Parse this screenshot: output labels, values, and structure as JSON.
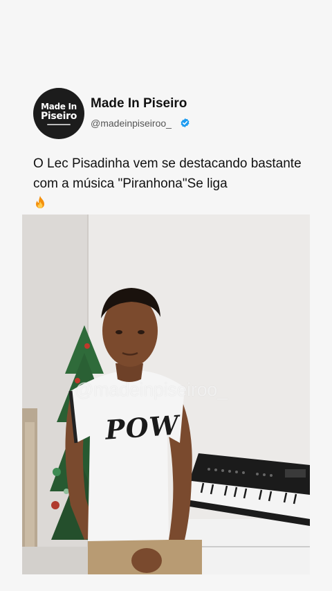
{
  "post": {
    "display_name": "Made In Piseiro",
    "handle": "@madeinpiseiroo_",
    "verified": true,
    "text": "O  Lec Pisadinha vem se destacando bastante com a música \"Piranhona\"Se liga",
    "emoji": "fire-icon"
  },
  "avatar": {
    "line1": "Made In",
    "line2": "Piseiro"
  },
  "media": {
    "watermark": "@madeinpiseiroo_",
    "shirt_text": "POW"
  },
  "colors": {
    "background": "#f6f6f6",
    "avatar_bg": "#1c1c1c",
    "verified": "#1d9bf0",
    "text": "#111111"
  }
}
